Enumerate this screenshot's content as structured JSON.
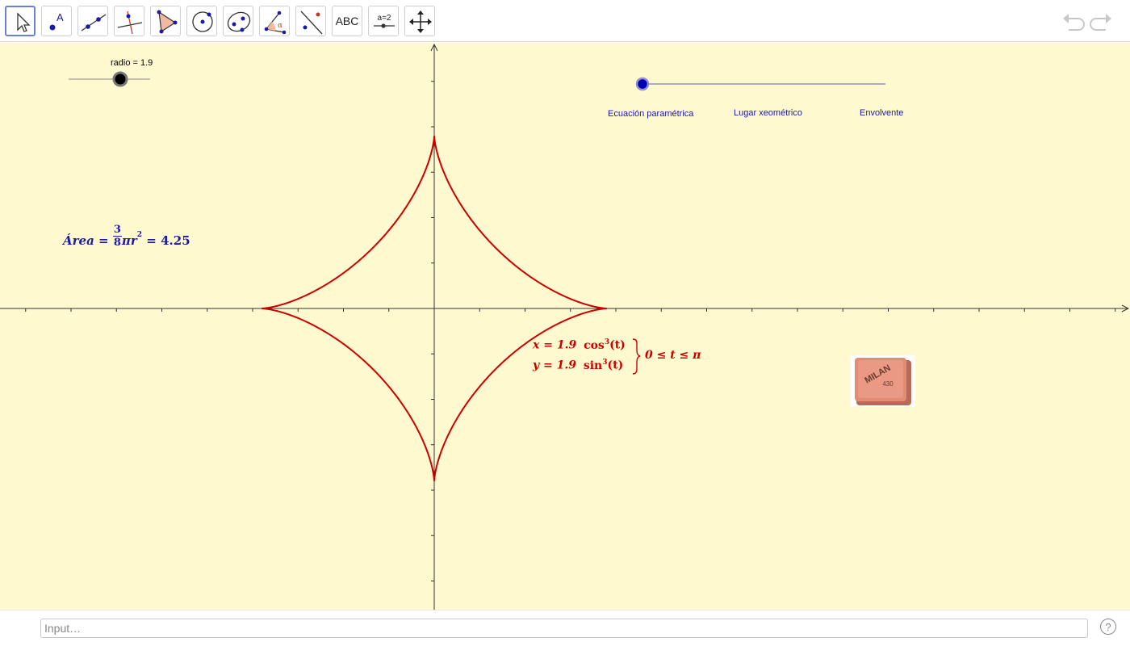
{
  "toolbar": {
    "tools": [
      {
        "name": "move-tool",
        "label": "",
        "icon": "cursor-arrow-icon",
        "active": true
      },
      {
        "name": "point-tool",
        "label": "A",
        "icon": "point-icon"
      },
      {
        "name": "line-tool",
        "label": "",
        "icon": "line-through-points-icon"
      },
      {
        "name": "perpendicular-line-tool",
        "label": "",
        "icon": "perpendicular-line-icon"
      },
      {
        "name": "polygon-tool",
        "label": "",
        "icon": "polygon-icon"
      },
      {
        "name": "circle-center-point-tool",
        "label": "",
        "icon": "circle-center-icon"
      },
      {
        "name": "ellipse-tool",
        "label": "",
        "icon": "ellipse-icon"
      },
      {
        "name": "angle-tool",
        "label": "α",
        "icon": "angle-icon"
      },
      {
        "name": "reflect-tool",
        "label": "",
        "icon": "reflect-about-line-icon"
      },
      {
        "name": "text-tool",
        "label": "ABC",
        "icon": "text-icon"
      },
      {
        "name": "slider-tool",
        "label": "a=2",
        "icon": "slider-icon"
      },
      {
        "name": "move-graphics-tool",
        "label": "",
        "icon": "move-arrows-icon"
      }
    ],
    "undo_icon": "undo-icon",
    "redo_icon": "redo-icon"
  },
  "graphics": {
    "slider_radio": {
      "label": "radio = 1.9",
      "value": 1.9
    },
    "animation_slider": {
      "value": 0
    },
    "menu": {
      "parametric": "Ecuación paramétrica",
      "locus": "Lugar xeométrico",
      "envelope": "Envolvente"
    },
    "area_formula": {
      "lhs": "Área",
      "eq1": "=",
      "num": "3",
      "den": "8",
      "pi_r": "πr",
      "exp": "2",
      "eq2": "=",
      "value": "4.25"
    },
    "parametric_formula": {
      "x_line": {
        "lhs": "x = 1.9",
        "func": "cos",
        "exp": "3",
        "arg": "(t)"
      },
      "y_line": {
        "lhs": "y = 1.9",
        "func": "sin",
        "exp": "3",
        "arg": "(t)"
      },
      "range": "0 ≤ t ≤ π"
    },
    "curve": {
      "type": "astroid",
      "radius": 1.9,
      "color": "#cc0000"
    },
    "formula_colors": {
      "area": "#1a1aa6",
      "parametric": "#cc0000"
    },
    "eraser_image": {
      "brand": "MILAN",
      "number": "430"
    }
  },
  "inputbar": {
    "placeholder": "Input…",
    "help_icon": "help-icon",
    "help_label": "?"
  }
}
